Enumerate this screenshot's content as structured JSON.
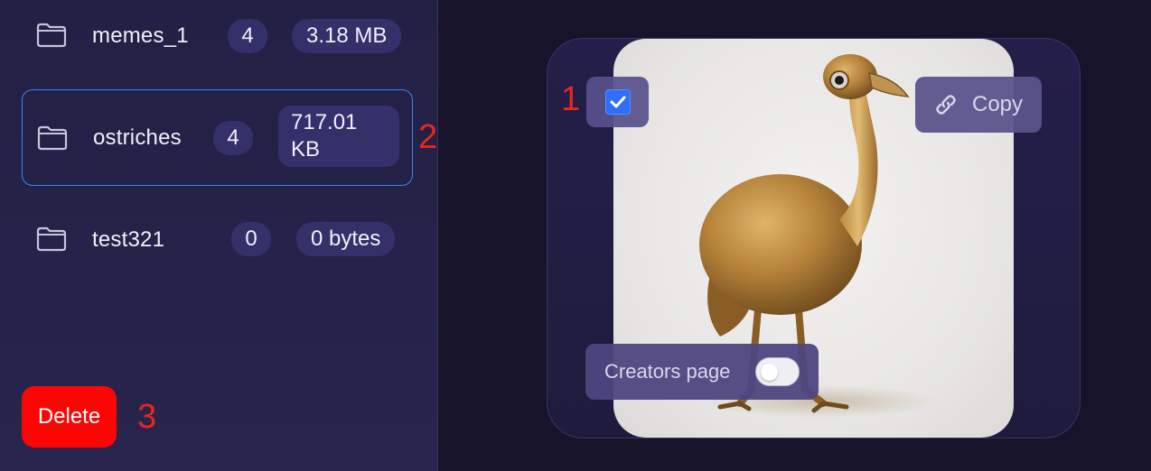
{
  "folders": [
    {
      "name": "memes_1",
      "count": "4",
      "size": "3.18 MB"
    },
    {
      "name": "ostriches",
      "count": "4",
      "size": "717.01 KB"
    },
    {
      "name": "test321",
      "count": "0",
      "size": "0 bytes"
    }
  ],
  "selected_folder_index": 1,
  "markers": {
    "one": "1",
    "two": "2",
    "three": "3"
  },
  "actions": {
    "delete_label": "Delete"
  },
  "card": {
    "checkbox_checked": true,
    "copy_label": "Copy",
    "creators_label": "Creators page",
    "creators_toggle_on": false
  },
  "icons": {
    "folder": "folder-icon",
    "check": "check-icon",
    "link": "link-icon"
  },
  "colors": {
    "sidebar_bg": "#232045",
    "main_bg": "#16132a",
    "pill_bg": "#34306a",
    "selected_border": "#3b86f0",
    "delete_bg": "#fe0505",
    "checkbox_bg": "#2f6ef7",
    "marker": "#e8261a"
  }
}
